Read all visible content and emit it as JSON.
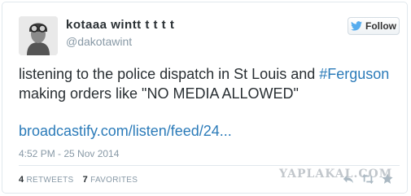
{
  "tweet": {
    "display_name": "kotaaa wintt t t t t",
    "handle": "@dakotawint",
    "follow_label": "Follow",
    "text_before": "listening to the police dispatch in St Louis and ",
    "hashtag": "#Ferguson",
    "text_after": " making orders like \"NO MEDIA ALLOWED\"",
    "link": "broadcastify.com/listen/feed/24...",
    "timestamp": "4:52 PM - 25 Nov 2014",
    "retweets_count": "4",
    "retweets_label": "RETWEETS",
    "favorites_count": "7",
    "favorites_label": "FAVORITES"
  },
  "watermark": "YAPLAKAL.COM",
  "colors": {
    "link": "#2b7bb9",
    "bird": "#55acee",
    "muted": "#8899a6"
  },
  "icons": [
    "twitter-bird-icon",
    "reply-icon",
    "retweet-icon",
    "favorite-icon"
  ]
}
